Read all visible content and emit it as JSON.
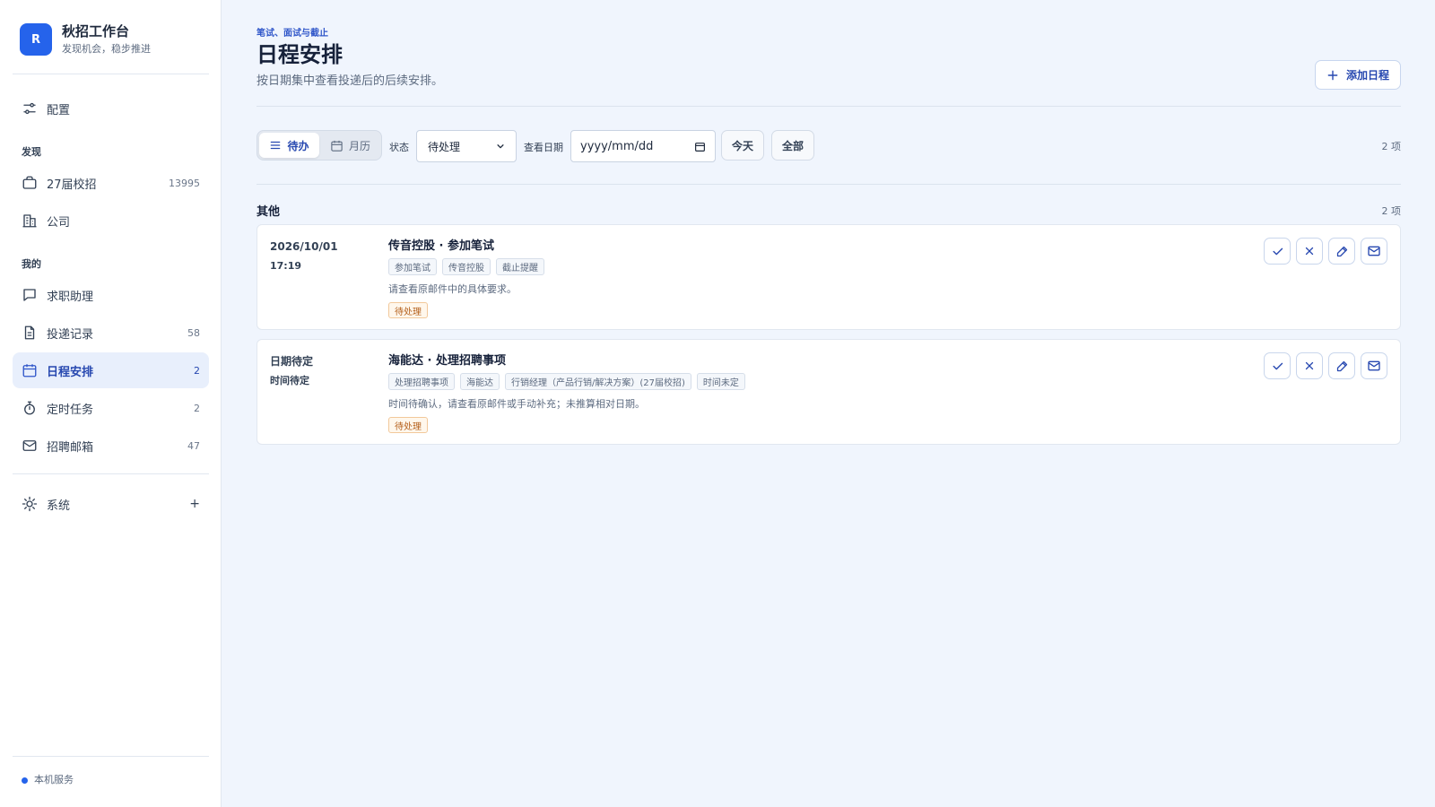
{
  "sidebar": {
    "logo_letter": "R",
    "app_title": "秋招工作台",
    "app_subtitle": "发现机会，稳步推进",
    "config_label": "配置",
    "section_discover": "发现",
    "section_mine": "我的",
    "items": [
      {
        "label": "27届校招",
        "count": "13995",
        "icon": "briefcase-icon"
      },
      {
        "label": "公司",
        "count": "",
        "icon": "building-icon"
      },
      {
        "label": "求职助理",
        "count": "",
        "icon": "chat-icon"
      },
      {
        "label": "投递记录",
        "count": "58",
        "icon": "document-icon"
      },
      {
        "label": "日程安排",
        "count": "2",
        "icon": "calendar-icon",
        "active": true
      },
      {
        "label": "定时任务",
        "count": "2",
        "icon": "stopwatch-icon"
      },
      {
        "label": "招聘邮箱",
        "count": "47",
        "icon": "mail-icon"
      }
    ],
    "system_label": "系统",
    "system_expand": "+",
    "footer_status": "本机服务",
    "accent_color": "#2563eb"
  },
  "header": {
    "eyebrow": "笔试、面试与截止",
    "title": "日程安排",
    "description": "按日期集中查看投递后的后续安排。",
    "add_button": "添加日程"
  },
  "toolbar": {
    "view_todo": "待办",
    "view_calendar": "月历",
    "status_label": "状态",
    "status_value": "待处理",
    "date_label": "查看日期",
    "date_placeholder": "yyyy/mm/dd",
    "today_button": "今天",
    "all_button": "全部",
    "total_count": "2 项"
  },
  "group": {
    "title": "其他",
    "count": "2 项"
  },
  "events": [
    {
      "date": "2026/10/01",
      "time": "17:19",
      "title": "传音控股 · 参加笔试",
      "tags": [
        "参加笔试",
        "传音控股",
        "截止提醒"
      ],
      "note": "请查看原邮件中的具体要求。",
      "status": "待处理"
    },
    {
      "date": "日期待定",
      "time": "时间待定",
      "title": "海能达 · 处理招聘事项",
      "tags": [
        "处理招聘事项",
        "海能达",
        "行销经理（产品行销/解决方案）(27届校招)",
        "时间未定"
      ],
      "note": "时间待确认，请查看原邮件或手动补充；未推算相对日期。",
      "status": "待处理"
    }
  ]
}
